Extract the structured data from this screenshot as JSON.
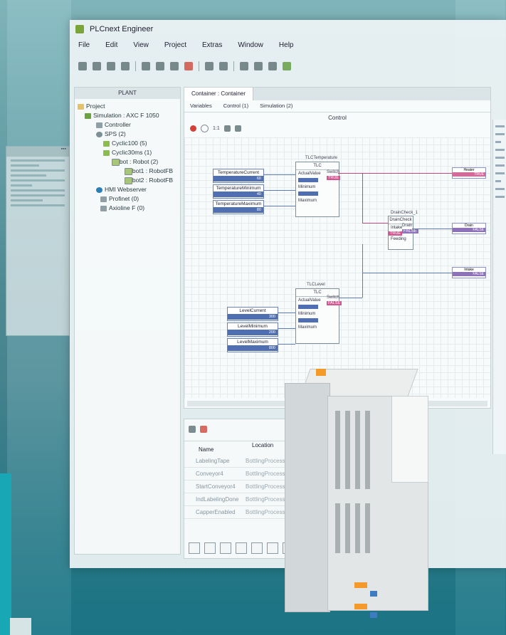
{
  "window": {
    "title": "PLCnext Engineer"
  },
  "menu": [
    "File",
    "Edit",
    "View",
    "Project",
    "Extras",
    "Window",
    "Help"
  ],
  "plant": {
    "header": "PLANT",
    "tree": [
      {
        "label": "Project",
        "icon": "folder-icon",
        "level": 0
      },
      {
        "label": "Simulation : AXC F 1050",
        "icon": "simulation-icon",
        "level": 1
      },
      {
        "label": "Controller",
        "icon": "controller-icon",
        "level": 2
      },
      {
        "label": "SPS (2)",
        "icon": "gear-icon",
        "level": 2
      },
      {
        "label": "Cyclic100 (5)",
        "icon": "task-icon",
        "level": 3
      },
      {
        "label": "Cyclic30ms (1)",
        "icon": "task-icon",
        "level": 3
      },
      {
        "label": "Robot : Robot (2)",
        "icon": "program-icon",
        "level": 4
      },
      {
        "label": "Robot1 : RobotFB",
        "icon": "function-block-icon",
        "level": 5
      },
      {
        "label": "Robot2 : RobotFB",
        "icon": "function-block-icon",
        "level": 5
      },
      {
        "label": "HMI Webserver",
        "icon": "web-icon",
        "level": 1
      },
      {
        "label": "Profinet (0)",
        "icon": "network-icon",
        "level": 1
      },
      {
        "label": "Axioline F (0)",
        "icon": "network-icon",
        "level": 1
      }
    ]
  },
  "editor": {
    "tab": "Container : Container",
    "subtabs": [
      "Variables",
      "Control (1)",
      "Simulation (2)"
    ],
    "pane_title": "Control",
    "zoom_label": "1:1",
    "blocks": {
      "tlc_temperature": {
        "instance": "TLCTemperature",
        "type": "TLC",
        "in_label": "ActualValue",
        "min_label": "Minimum",
        "max_label": "Maximum",
        "out_label": "Switch",
        "out_value": "TRUE"
      },
      "tlc_level": {
        "instance": "TLCLevel",
        "type": "TLC",
        "in_label": "ActualValue",
        "min_label": "Minimum",
        "max_label": "Maximum",
        "out_label": "Switch",
        "out_value": "FALSE"
      },
      "drain_check": {
        "instance": "DrainCheck_1",
        "type": "DrainCheck",
        "in1": "Intake",
        "in2": "Feeding",
        "out": "Drain",
        "out_value": "FALSE",
        "in_value": "TRUE"
      }
    },
    "variables": [
      {
        "name": "TemperatureCurrent",
        "value": "60"
      },
      {
        "name": "TemperatureMinimum",
        "value": "40"
      },
      {
        "name": "TemperatureMaximum",
        "value": "80"
      },
      {
        "name": "LevelCurrent",
        "value": "300"
      },
      {
        "name": "LevelMinimum",
        "value": "200"
      },
      {
        "name": "LevelMaximum",
        "value": "800"
      }
    ],
    "outputs": [
      {
        "name": "Heater",
        "value": "TRUE"
      },
      {
        "name": "Drain",
        "value": "FALSE"
      },
      {
        "name": "Intake",
        "value": "FALSE"
      }
    ]
  },
  "list": {
    "columns": [
      "Name",
      "Location"
    ],
    "rows": [
      {
        "name": "LabelingTape",
        "location": "BottlingProcess : Variables"
      },
      {
        "name": "Conveyor4",
        "location": "BottlingProcess : Variables"
      },
      {
        "name": "StartConveyor4",
        "location": "BottlingProcess : Variables"
      },
      {
        "name": "IndLabelingDone",
        "location": "BottlingProcess : Variables"
      },
      {
        "name": "CapperEnabled",
        "location": "BottlingProcess : Variables"
      }
    ]
  },
  "colors": {
    "accent": "#18a7b5",
    "brand_green": "#7aa53a",
    "wire_blue": "#5d79b6",
    "wire_pink": "#c2487c",
    "led_orange": "#f39a2a"
  }
}
